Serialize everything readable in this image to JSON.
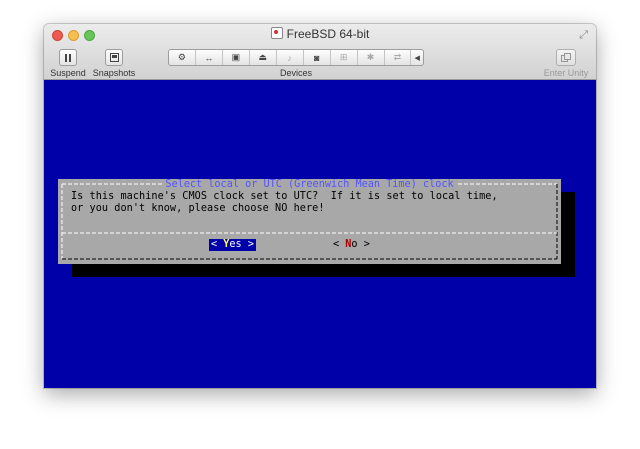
{
  "window": {
    "title": "FreeBSD 64-bit"
  },
  "toolbar": {
    "suspend_label": "Suspend",
    "snapshots_label": "Snapshots",
    "devices_label": "Devices",
    "enter_unity_label": "Enter Unity"
  },
  "devices": [
    {
      "name": "settings-wrench-icon",
      "glyph": "⚙"
    },
    {
      "name": "network-icon",
      "glyph": "↔"
    },
    {
      "name": "hard-disk-icon",
      "glyph": "▣"
    },
    {
      "name": "cd-drive-icon",
      "glyph": "⏏"
    },
    {
      "name": "sound-icon",
      "glyph": "♪"
    },
    {
      "name": "camera-icon",
      "glyph": "◙"
    },
    {
      "name": "usb-icon",
      "glyph": "⊞"
    },
    {
      "name": "bluetooth-icon",
      "glyph": "✱"
    },
    {
      "name": "shared-folders-icon",
      "glyph": "⇄"
    }
  ],
  "dialog": {
    "title": "Select local or UTC (Greenwich Mean Time) clock",
    "message_line1": "Is this machine's CMOS clock set to UTC?  If it is set to local time,",
    "message_line2": "or you don't know, please choose NO here!",
    "yes_button": {
      "left": "< ",
      "hotkey": "Y",
      "rest": "es >"
    },
    "no_button": {
      "left": "< ",
      "hotkey": "N",
      "rest": "o >"
    }
  },
  "colors": {
    "screen_bg": "#0000a8",
    "dialog_bg": "#a8a8a8",
    "dialog_title": "#5454fc",
    "selected_button_bg": "#0000a8",
    "hotkey_selected": "#fcfc54",
    "hotkey_unselected": "#a80000"
  }
}
